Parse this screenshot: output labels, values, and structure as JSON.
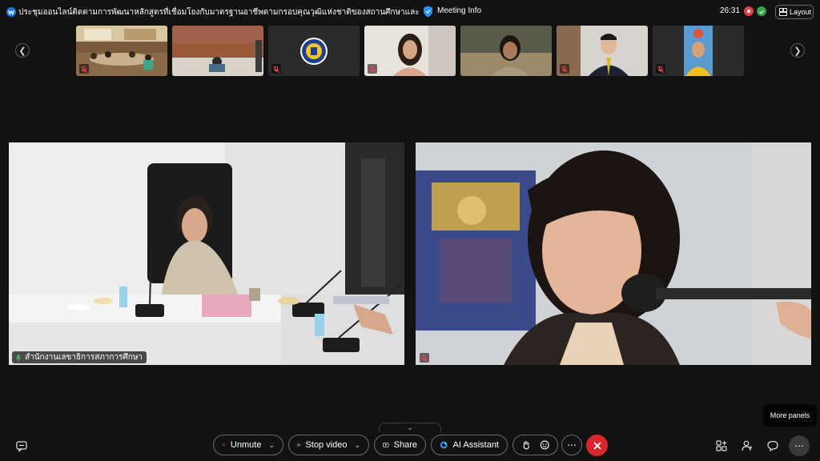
{
  "header": {
    "meeting_title": "ประชุมออนไลน์ติดตามการพัฒนาหลักสูตรที่เชื่อมโยงกับมาตรฐานอาชีพตามกรอบคุณวุฒิแห่งชาติของสถานศึกษาและสถาบันฝึกอบรมในจังหวัดภูเก็ต",
    "meeting_info_label": "Meeting Info",
    "timer": "26:31",
    "layout_label": "Layout"
  },
  "main": {
    "left_participant_name": "สำนักงานเลขาธิการสภาการศึกษา"
  },
  "controls": {
    "unmute_label": "Unmute",
    "stop_video_label": "Stop video",
    "share_label": "Share",
    "ai_assistant_label": "AI Assistant",
    "more_panels_tooltip": "More panels"
  },
  "colors": {
    "background": "#121212",
    "leave_red": "#d8262f",
    "recording_red": "#e0404c",
    "secure_green": "#3aa04e"
  }
}
